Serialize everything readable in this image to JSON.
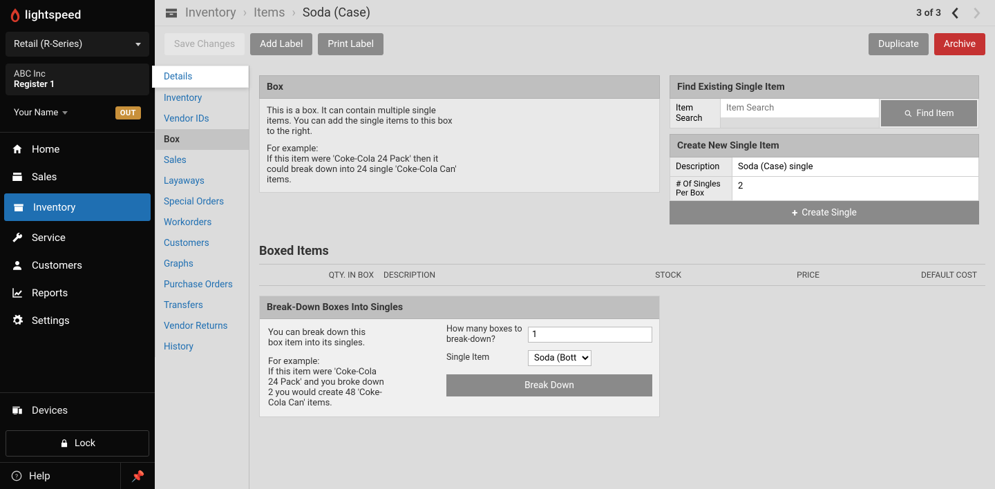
{
  "brand": "lightspeed",
  "product_selector": "Retail (R-Series)",
  "company": "ABC Inc",
  "register": "Register 1",
  "user_name": "Your Name",
  "out_badge": "OUT",
  "nav": {
    "home": "Home",
    "sales": "Sales",
    "inventory": "Inventory",
    "service": "Service",
    "customers": "Customers",
    "reports": "Reports",
    "settings": "Settings",
    "devices": "Devices",
    "lock": "Lock",
    "help": "Help"
  },
  "breadcrumb": {
    "level1": "Inventory",
    "level2": "Items",
    "current": "Soda (Case)"
  },
  "pager": {
    "text": "3 of 3"
  },
  "actions": {
    "save": "Save Changes",
    "add_label": "Add Label",
    "print_label": "Print Label",
    "duplicate": "Duplicate",
    "archive": "Archive"
  },
  "tabs": {
    "details": "Details",
    "inventory": "Inventory",
    "vendor_ids": "Vendor IDs",
    "box": "Box",
    "sales": "Sales",
    "layaways": "Layaways",
    "special_orders": "Special Orders",
    "workorders": "Workorders",
    "customers": "Customers",
    "graphs": "Graphs",
    "purchase_orders": "Purchase Orders",
    "transfers": "Transfers",
    "vendor_returns": "Vendor Returns",
    "history": "History"
  },
  "box_panel": {
    "title": "Box",
    "desc1": "This is a box. It can contain multiple single items. You can add the single items to this box to the right.",
    "desc2a": "For example:",
    "desc2b": "If this item were 'Coke-Cola 24 Pack' then it could break down into 24 single 'Coke-Cola Can' items."
  },
  "find_panel": {
    "title": "Find Existing Single Item",
    "search_label": "Item Search",
    "search_placeholder": "Item Search",
    "find_btn": "Find Item"
  },
  "create_panel": {
    "title": "Create New Single Item",
    "desc_label": "Description",
    "desc_value": "Soda (Case) single",
    "singles_label": "# Of Singles Per Box",
    "singles_value": "2",
    "create_btn": "Create Single"
  },
  "boxed_items": {
    "title": "Boxed Items",
    "cols": {
      "qty": "QTY. IN BOX",
      "desc": "DESCRIPTION",
      "stock": "STOCK",
      "price": "PRICE",
      "cost": "DEFAULT COST"
    }
  },
  "breakdown": {
    "title": "Break-Down Boxes Into Singles",
    "p1": "You can break down this box item into its singles.",
    "p2a": "For example:",
    "p2b": "If this item were 'Coke-Cola 24 Pack' and you broke down 2 you would create 48 'Coke-Cola Can' items.",
    "how_many_label": "How many boxes to break-down?",
    "how_many_value": "1",
    "single_item_label": "Single Item",
    "single_item_value": "Soda (Bottle)",
    "btn": "Break Down"
  }
}
